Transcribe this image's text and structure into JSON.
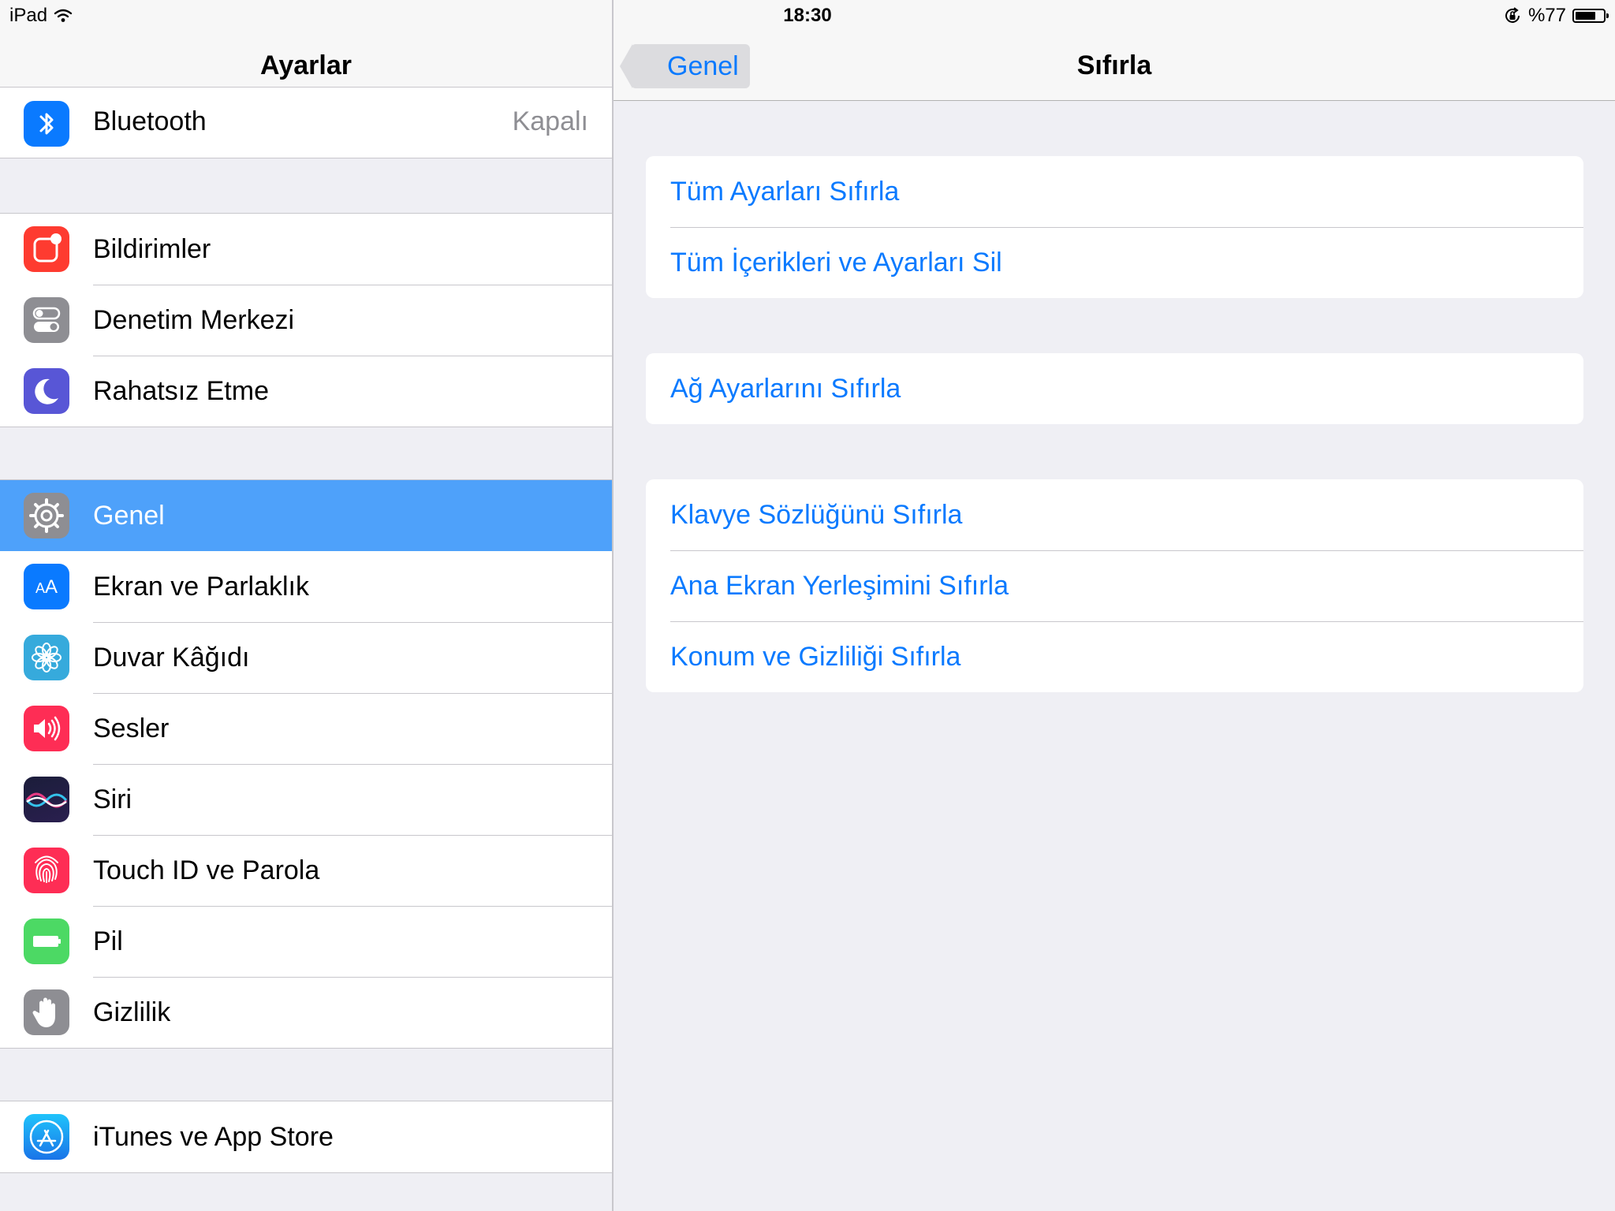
{
  "status_bar": {
    "device": "iPad",
    "time": "18:30",
    "battery_text": "%77",
    "battery_level": 0.77
  },
  "master": {
    "title": "Ayarlar",
    "bluetooth": {
      "label": "Bluetooth",
      "detail": "Kapalı"
    },
    "group_a": [
      {
        "label": "Bildirimler"
      },
      {
        "label": "Denetim Merkezi"
      },
      {
        "label": "Rahatsız Etme"
      }
    ],
    "group_b": [
      {
        "label": "Genel",
        "selected": true
      },
      {
        "label": "Ekran ve Parlaklık"
      },
      {
        "label": "Duvar Kâğıdı"
      },
      {
        "label": "Sesler"
      },
      {
        "label": "Siri"
      },
      {
        "label": "Touch ID ve Parola"
      },
      {
        "label": "Pil"
      },
      {
        "label": "Gizlilik"
      }
    ],
    "group_c": [
      {
        "label": "iTunes ve App Store"
      }
    ]
  },
  "detail": {
    "back_label": "Genel",
    "title": "Sıfırla",
    "group_1": [
      {
        "label": "Tüm Ayarları Sıfırla"
      },
      {
        "label": "Tüm İçerikleri ve Ayarları Sil"
      }
    ],
    "group_2": [
      {
        "label": "Ağ Ayarlarını Sıfırla"
      }
    ],
    "group_3": [
      {
        "label": "Klavye Sözlüğünü Sıfırla"
      },
      {
        "label": "Ana Ekran Yerleşimini Sıfırla"
      },
      {
        "label": "Konum ve Gizliliği Sıfırla"
      }
    ]
  },
  "colors": {
    "tint": "#0a7aff",
    "selection": "#4ea1fa",
    "background": "#efeff4"
  },
  "icons": {
    "bluetooth": "bluetooth-icon",
    "notifications": "notifications-icon",
    "control_center": "control-center-icon",
    "do_not_disturb": "moon-icon",
    "general": "gear-icon",
    "display": "display-brightness-icon",
    "wallpaper": "wallpaper-flower-icon",
    "sounds": "speaker-icon",
    "siri": "siri-icon",
    "touch_id": "fingerprint-icon",
    "battery": "battery-icon",
    "privacy": "hand-icon",
    "app_store": "app-store-icon"
  }
}
